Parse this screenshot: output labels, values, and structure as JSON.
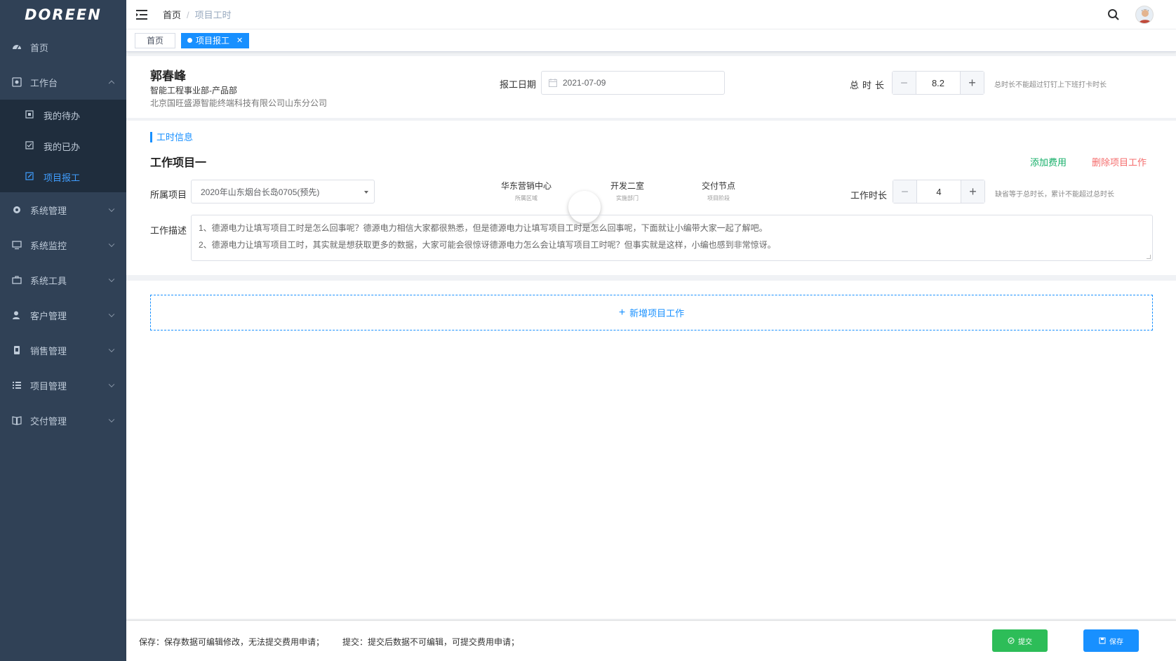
{
  "colors": {
    "sidebar_bg": "#304156",
    "accent": "#1890ff",
    "add_fee": "#13ae67",
    "delete": "#f56c6c",
    "submit": "#2dbd58"
  },
  "sidebar": {
    "logo": "DOREEN",
    "items": [
      {
        "label": "首页",
        "icon": "dashboard-icon"
      },
      {
        "label": "工作台",
        "icon": "workbench-icon",
        "expanded": true,
        "children": [
          {
            "label": "我的待办",
            "icon": "todo-icon"
          },
          {
            "label": "我的已办",
            "icon": "done-icon"
          },
          {
            "label": "项目报工",
            "icon": "edit-icon",
            "active": true
          }
        ]
      },
      {
        "label": "系统管理",
        "icon": "gear-icon"
      },
      {
        "label": "系统监控",
        "icon": "monitor-icon"
      },
      {
        "label": "系统工具",
        "icon": "toolbox-icon"
      },
      {
        "label": "客户管理",
        "icon": "user-icon"
      },
      {
        "label": "销售管理",
        "icon": "sales-icon"
      },
      {
        "label": "项目管理",
        "icon": "list-icon"
      },
      {
        "label": "交付管理",
        "icon": "book-icon"
      }
    ]
  },
  "header": {
    "breadcrumb": [
      "首页",
      "项目工时"
    ]
  },
  "tags": [
    {
      "label": "首页"
    },
    {
      "label": "项目报工",
      "active": true
    }
  ],
  "employee": {
    "name": "郭春峰",
    "dept": "智能工程事业部-产品部",
    "company": "北京国旺盛源智能终端科技有限公司山东分公司"
  },
  "report": {
    "date_label": "报工日期",
    "date_value": "2021-07-09",
    "total_label": "总时长",
    "total_value": "8.2",
    "total_hint": "总时长不能超过钉钉上下班打卡时长"
  },
  "work": {
    "section_title": "工时信息",
    "title": "工作项目一",
    "add_fee": "添加费用",
    "delete": "删除项目工作",
    "project_label": "所属项目",
    "project_value": "2020年山东烟台长岛0705(预先)",
    "region_value": "华东营销中心",
    "region_key": "所属区域",
    "dept_value": "开发二室",
    "dept_key": "实施部门",
    "stage_value": "交付节点",
    "stage_key": "项目阶段",
    "duration_label": "工作时长",
    "duration_value": "4",
    "duration_hint": "缺省等于总时长，累计不能超过总时长",
    "desc_label": "工作描述",
    "desc_line1": "1、德源电力让填写项目工时是怎么回事呢？德源电力相信大家都很熟悉，但是德源电力让填写项目工时是怎么回事呢，下面就让小编带大家一起了解吧。",
    "desc_line2": "2、德源电力让填写项目工时，其实就是想获取更多的数据，大家可能会很惊讶德源电力怎么会让填写项目工时呢？但事实就是这样，小编也感到非常惊讶。"
  },
  "add_work": "新增项目工作",
  "footer": {
    "note_save": "保存：保存数据可编辑修改，无法提交费用申请；",
    "note_submit": "提交：提交后数据不可编辑，可提交费用申请；",
    "submit": "提交",
    "save": "保存"
  }
}
